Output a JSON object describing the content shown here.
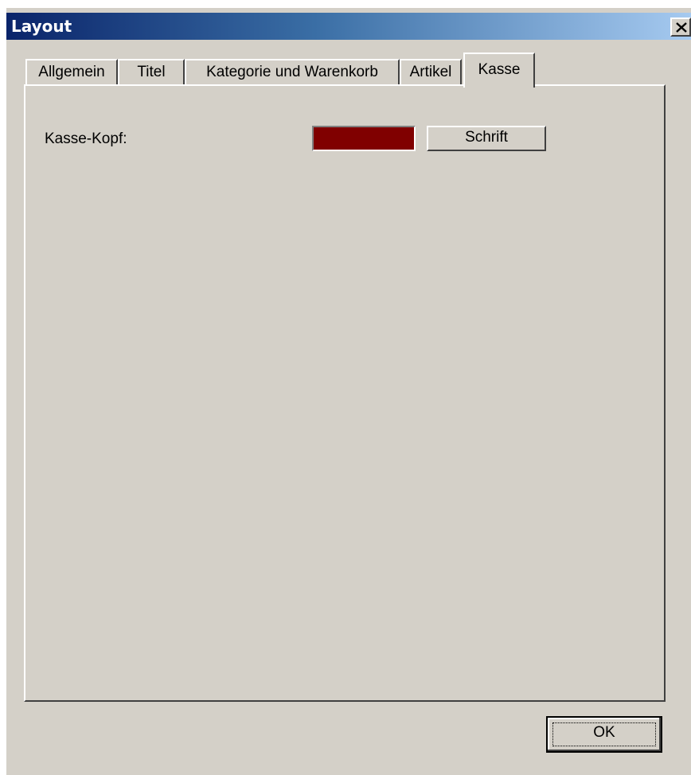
{
  "window": {
    "title": "Layout",
    "close_icon": "close-icon"
  },
  "tabs": [
    {
      "label": "Allgemein",
      "active": false
    },
    {
      "label": "Titel",
      "active": false
    },
    {
      "label": "Kategorie und Warenkorb",
      "active": false
    },
    {
      "label": "Artikel",
      "active": false
    },
    {
      "label": "Kasse",
      "active": true
    }
  ],
  "panel": {
    "header_label": "Kasse-Kopf:",
    "color_value": "#800000",
    "font_button_label": "Schrift"
  },
  "footer": {
    "ok_label": "OK"
  }
}
